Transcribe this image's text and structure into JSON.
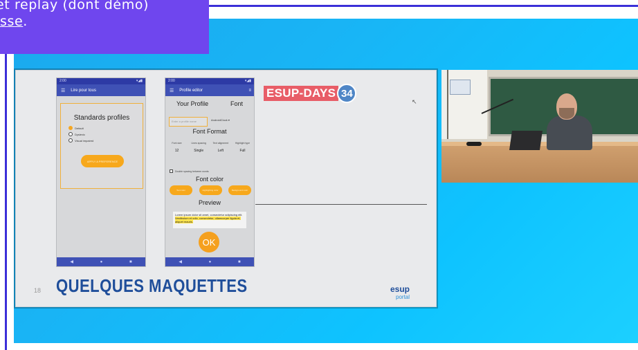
{
  "caption": {
    "line1": "et replay (dont démo)",
    "line2_link": "sse",
    "line2_tail": "."
  },
  "slide": {
    "number": "18",
    "title": "QUELQUES MAQUETTES",
    "event_label": "ESUP-DAYS",
    "event_number": "34",
    "logo_main": "esup",
    "logo_sub": "portal"
  },
  "phone1": {
    "status_time": "2:00",
    "app_title": "Lire pour tous",
    "profiles_title": "Standards profiles",
    "options": [
      "Default",
      "Dyslexic",
      "Visual impaired"
    ],
    "selected_index": 0,
    "apply_button": "APPLY A PREFERENCE"
  },
  "phone2": {
    "status_time": "2:00",
    "app_title": "Profile editor",
    "your_profile": "Your Profile",
    "font": "Font",
    "name_placeholder": "Enter a profile name",
    "font_value": "AndroidClock",
    "font_format": "Font Format",
    "fmt": [
      {
        "label": "Font size",
        "value": "12"
      },
      {
        "label": "Lines spacing",
        "value": "Single"
      },
      {
        "label": "Text alignment",
        "value": "Left"
      },
      {
        "label": "Highlight type",
        "value": "Full"
      }
    ],
    "double_spacing": "Double spacing between words",
    "font_color": "Font color",
    "color_buttons": [
      "Text color",
      "Highlighting color",
      "Background color"
    ],
    "preview": "Preview",
    "preview_text_plain": "Lorem ipsum dolor sit amet, consectetur adipiscing elit. ",
    "preview_text_hl": "Vestibulum et odio, consectetur, ullamcorper ligula et, aliquet mauris.",
    "ok": "OK"
  },
  "colors": {
    "accent_purple": "#6f46ee",
    "rule_blue": "#3b2fd8",
    "video_blue": "#19b4f5",
    "android_indigo": "#3f51b5",
    "orange": "#f7a81c",
    "title_blue": "#1f4e9a",
    "event_red": "#e85d67",
    "event_badge": "#4f86c6"
  }
}
